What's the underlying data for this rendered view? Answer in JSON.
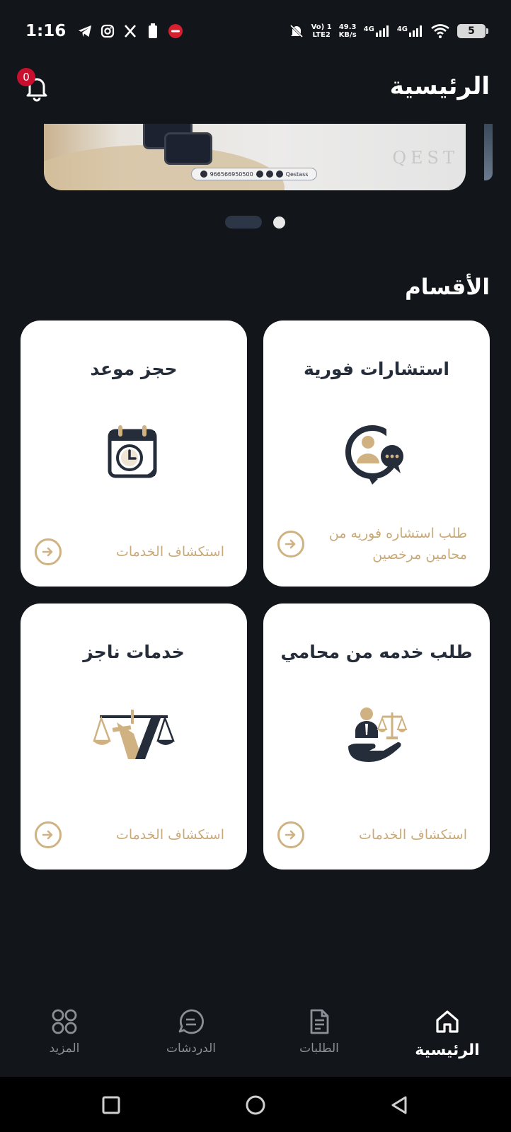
{
  "status_bar": {
    "time": "1:16",
    "network_top": "Vo) 1",
    "network_bottom": "LTE2",
    "speed_value": "49.3",
    "speed_unit": "KB/s",
    "signal1_label": "4G",
    "signal2_label": "4G",
    "battery": "5",
    "left_icons": [
      "telegram-icon",
      "instagram-icon",
      "x-icon",
      "battery-saver-icon",
      "app-notification-icon"
    ],
    "right_icons": [
      "mute-icon",
      "signal-icon",
      "signal-icon",
      "wifi-icon"
    ]
  },
  "header": {
    "title": "الرئيسية",
    "notification_count": "0"
  },
  "banner": {
    "phone": "966566950500",
    "handle": "Qestass",
    "watermark": "QEST",
    "pages": 2,
    "active_page": 1
  },
  "sections": {
    "title": "الأقسام",
    "cards": [
      {
        "title": "استشارات فورية",
        "desc": "طلب استشاره فوريه من محامين مرخصين",
        "icon": "consultation-chat-icon"
      },
      {
        "title": "حجز موعد",
        "desc": "استكشاف الخدمات",
        "icon": "calendar-clock-icon"
      },
      {
        "title": "طلب خدمه من محامي",
        "desc": "استكشاف الخدمات",
        "icon": "lawyer-scales-icon"
      },
      {
        "title": "خدمات ناجز",
        "desc": "استكشاف الخدمات",
        "icon": "najiz-logo-icon"
      }
    ]
  },
  "bottom_nav": {
    "items": [
      {
        "label": "الرئيسية",
        "icon": "home-icon",
        "active": true
      },
      {
        "label": "الطلبات",
        "icon": "document-icon",
        "active": false
      },
      {
        "label": "الدردشات",
        "icon": "chat-icon",
        "active": false
      },
      {
        "label": "المزيد",
        "icon": "grid-icon",
        "active": false
      }
    ]
  },
  "colors": {
    "background": "#12151a",
    "card": "#ffffff",
    "navy": "#252c3a",
    "gold": "#c9a977",
    "badge": "#c8102e"
  }
}
